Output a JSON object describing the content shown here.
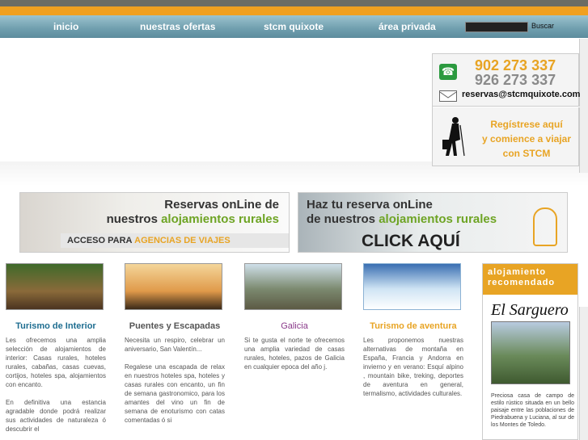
{
  "nav": {
    "items": [
      "inicio",
      "nuestras ofertas",
      "stcm quixote",
      "área privada"
    ],
    "search_label": "Buscar"
  },
  "contact": {
    "phone1": "902 273 337",
    "phone2": "926 273 337",
    "email": "reservas@stcmquixote.com",
    "register_line1": "Regístrese aquí",
    "register_line2": "y comience a viajar",
    "register_line3": "con STCM"
  },
  "banners": {
    "left": {
      "line1": "Reservas onLine de",
      "line2_prefix": "nuestros",
      "line2_highlight": "alojamientos rurales",
      "line3_prefix": "ACCESO PARA",
      "line3_highlight": "AGENCIAS DE VIAJES"
    },
    "right": {
      "line1": "Haz tu reserva onLine",
      "line2_prefix": "de nuestros",
      "line2_highlight": "alojamientos rurales",
      "line3": "CLICK AQUÍ"
    }
  },
  "columns": [
    {
      "title": "Turismo de Interior",
      "text": "Les ofrecemos una amplia selección de alojamientos de interior: Casas rurales, hoteles rurales, cabañas, casas cuevas, cortijos, hoteles spa, alojamientos con encanto.\n\nEn definitiva una estancia agradable donde podrá realizar sus actividades de naturaleza ó descubrir el"
    },
    {
      "title": "Puentes y Escapadas",
      "text": "Necesita un respiro, celebrar un aniversario, San Valentín...\n\nRegalese una escapada de relax en nuestros hoteles spa, hoteles y casas rurales con encanto, un fin de semana gastronomico, para los amantes del vino un fin de semana de enoturismo con catas comentadas ó si"
    },
    {
      "title": "Galicia",
      "text": "Si te gusta el norte te ofrecemos una amplia variedad de casas rurales, hoteles, pazos de Galicia en cualquier epoca del año j."
    },
    {
      "title": "Turismo de aventura",
      "text": "Les proponemos nuestras alternativas de montaña en España, Francia y Andorra en invierno y en verano: Esquí alpino , mountain bike, treking, deportes de aventura en general, termalismo, actividades culturales."
    }
  ],
  "recommended": {
    "header": "alojamiento recomendado",
    "logo": "El Sarguero",
    "text": "Preciosa casa de campo de estilo rústico situada en un bello paisaje entre las poblaciones de Piedrabuena y Luciana, al sur de los Montes de Toledo."
  }
}
